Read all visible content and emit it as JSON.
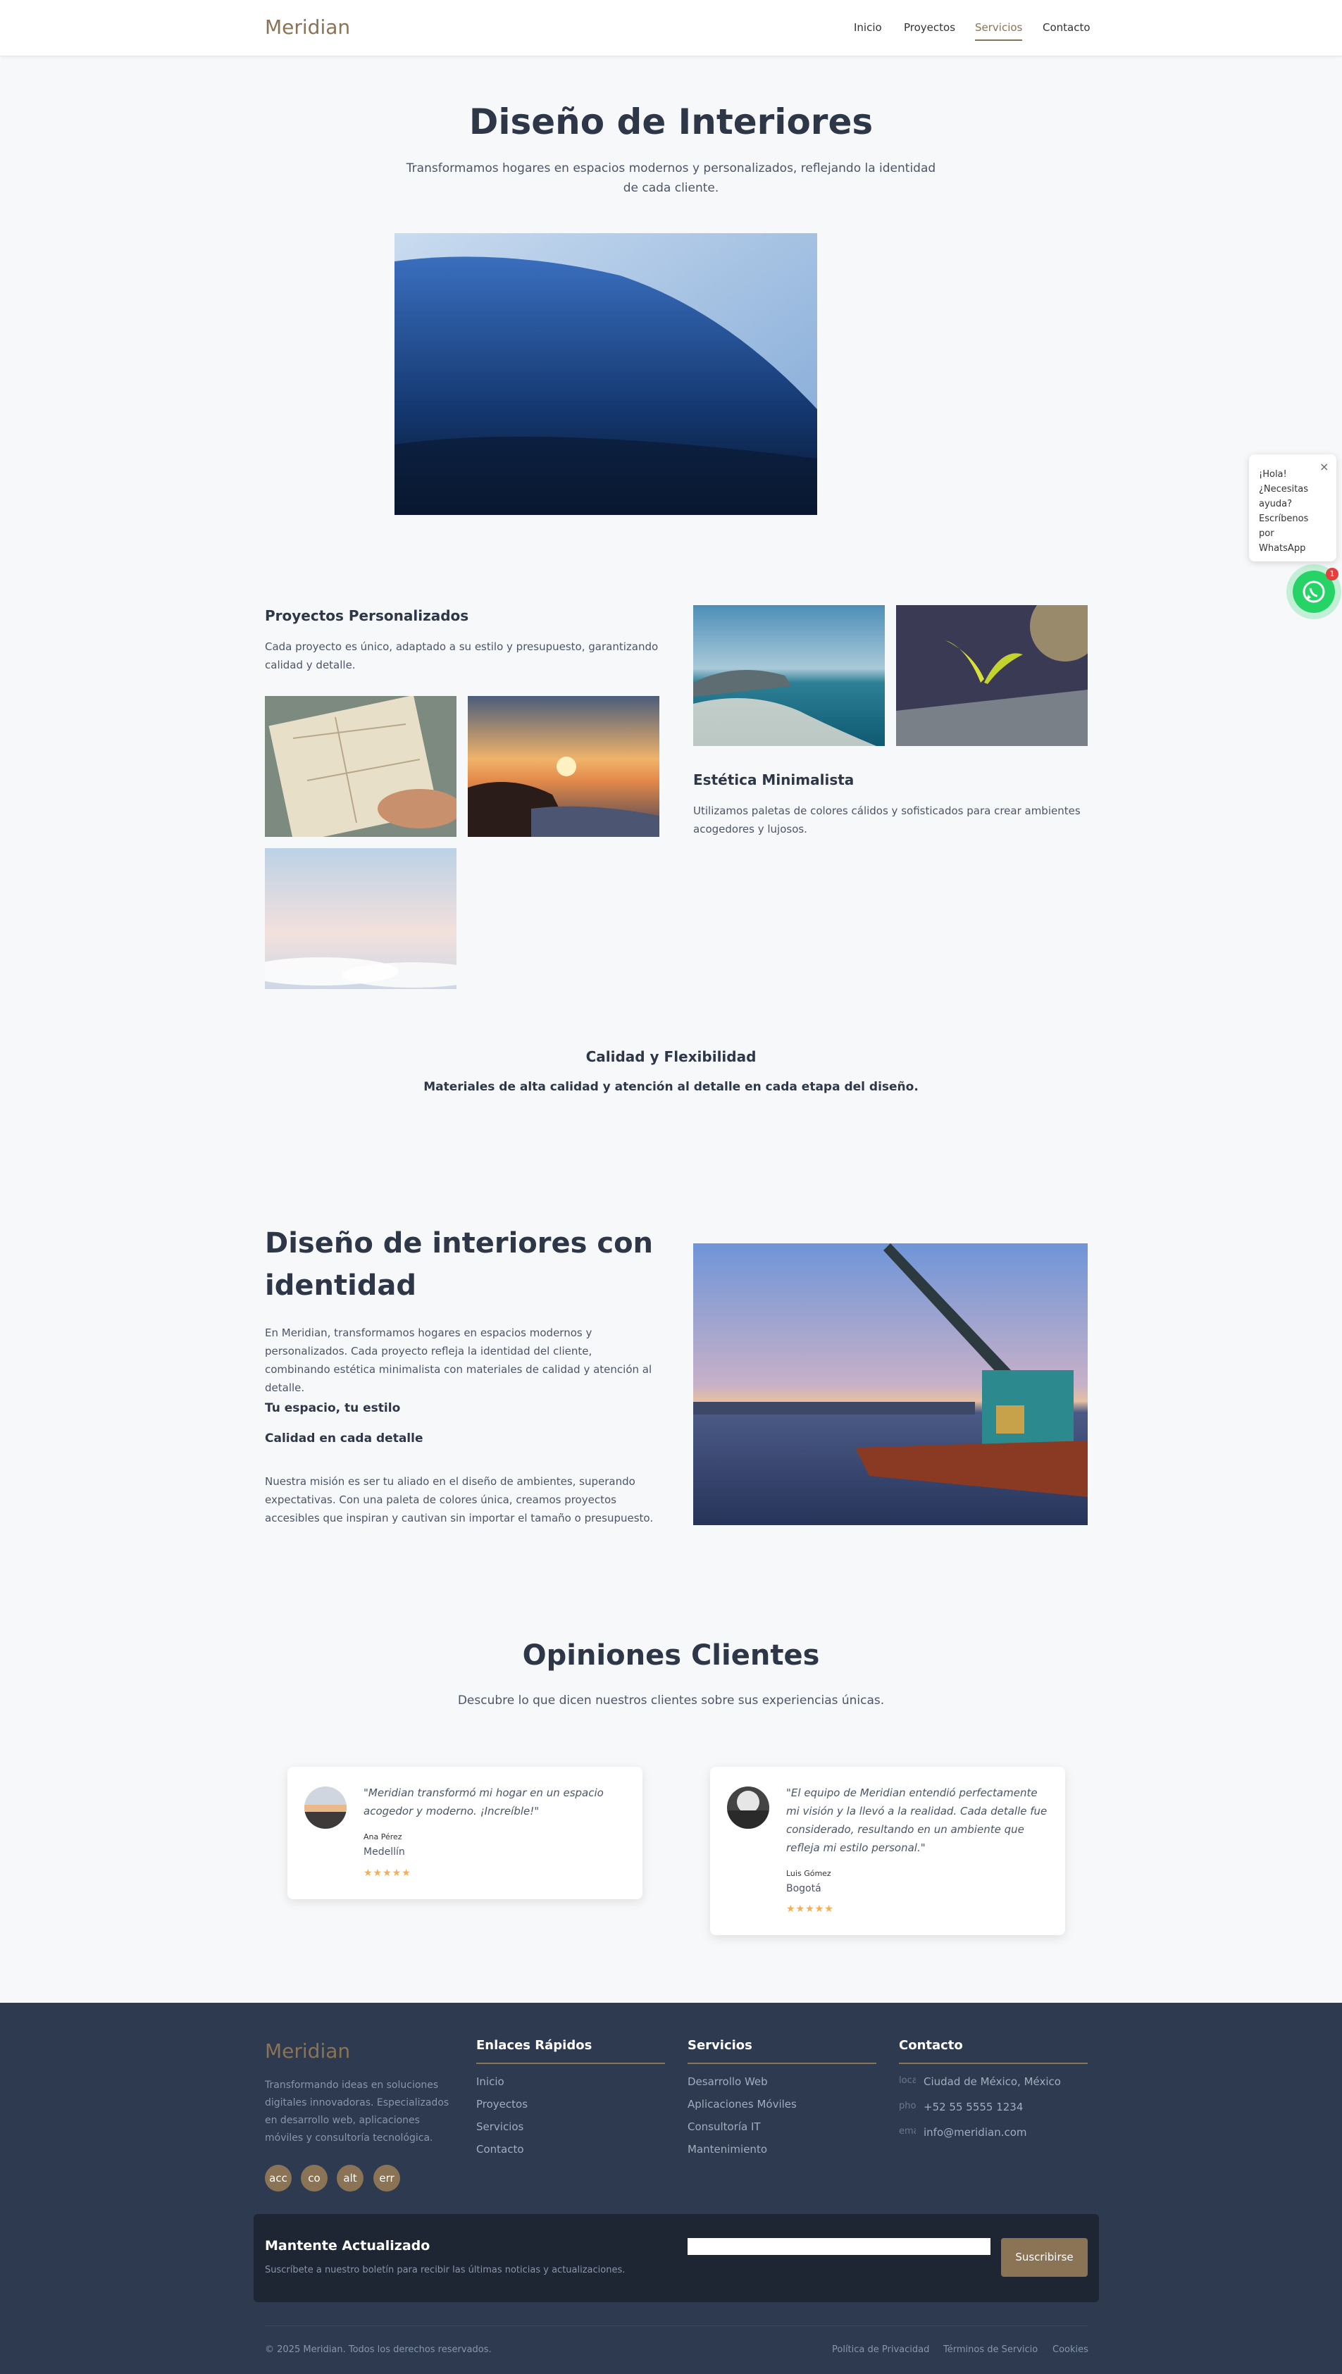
{
  "brand": "Meridian",
  "nav": {
    "items": [
      "Inicio",
      "Proyectos",
      "Servicios",
      "Contacto"
    ],
    "active": "Servicios"
  },
  "hero": {
    "title": "Diseño de Interiores",
    "subtitle": "Transformamos hogares en espacios modernos y personalizados, reflejando la identidad de cada cliente."
  },
  "features": {
    "custom": {
      "title": "Proyectos Personalizados",
      "text": "Cada proyecto es único, adaptado a su estilo y presupuesto, garantizando calidad y detalle."
    },
    "minimal": {
      "title": "Estética Minimalista",
      "text": "Utilizamos paletas de colores cálidos y sofisticados para crear ambientes acogedores y lujosos."
    },
    "quality": {
      "title": "Calidad y Flexibilidad",
      "text": "Materiales de alta calidad y atención al detalle en cada etapa del diseño."
    }
  },
  "about": {
    "title": "Diseño de interiores con identidad",
    "text1": "En Meridian, transformamos hogares en espacios modernos y personalizados. Cada proyecto refleja la identidad del cliente, combinando estética minimalista con materiales de calidad y atención al detalle.",
    "tag1": "Tu espacio, tu estilo",
    "tag2": "Calidad en cada detalle",
    "text2": "Nuestra misión es ser tu aliado en el diseño de ambientes, superando expectativas. Con una paleta de colores única, creamos proyectos accesibles que inspiran y cautivan sin importar el tamaño o presupuesto."
  },
  "testimonials": {
    "title": "Opiniones Clientes",
    "subtitle": "Descubre lo que dicen nuestros clientes sobre sus experiencias únicas.",
    "items": [
      {
        "quote": "\"Meridian transformó mi hogar en un espacio acogedor y moderno. ¡Increíble!\"",
        "name": "Ana Pérez",
        "city": "Medellín",
        "stars": "★★★★★"
      },
      {
        "quote": "\"El equipo de Meridian entendió perfectamente mi visión y la llevó a la realidad. Cada detalle fue considerado, resultando en un ambiente que refleja mi estilo personal.\"",
        "name": "Luis Gómez",
        "city": "Bogotá",
        "stars": "★★★★★"
      }
    ]
  },
  "whatsapp": {
    "bubble": "¡Hola! ¿Necesitas ayuda? Escríbenos por WhatsApp",
    "close": "×",
    "badge": "1"
  },
  "footer": {
    "brand": "Meridian",
    "description": "Transformando ideas en soluciones digitales innovadoras. Especializados en desarrollo web, aplicaciones móviles y consultoría tecnológica.",
    "social": [
      "acc",
      "co",
      "alt",
      "err"
    ],
    "quick_links": {
      "title": "Enlaces Rápidos",
      "items": [
        "Inicio",
        "Proyectos",
        "Servicios",
        "Contacto"
      ]
    },
    "services": {
      "title": "Servicios",
      "items": [
        "Desarrollo Web",
        "Aplicaciones Móviles",
        "Consultoría IT",
        "Mantenimiento"
      ]
    },
    "contact": {
      "title": "Contacto",
      "items": [
        {
          "icon": "loca",
          "text": "Ciudad de México, México"
        },
        {
          "icon": "pho",
          "text": "+52 55 5555 1234"
        },
        {
          "icon": "ema",
          "text": "info@meridian.com"
        }
      ]
    },
    "newsletter": {
      "title": "Mantente Actualizado",
      "text": "Suscríbete a nuestro boletín para recibir las últimas noticias y actualizaciones.",
      "button": "Suscribirse",
      "placeholder": ""
    },
    "copyright": "© 2025 Meridian. Todos los derechos reservados.",
    "legal": [
      "Política de Privacidad",
      "Términos de Servicio",
      "Cookies"
    ]
  }
}
